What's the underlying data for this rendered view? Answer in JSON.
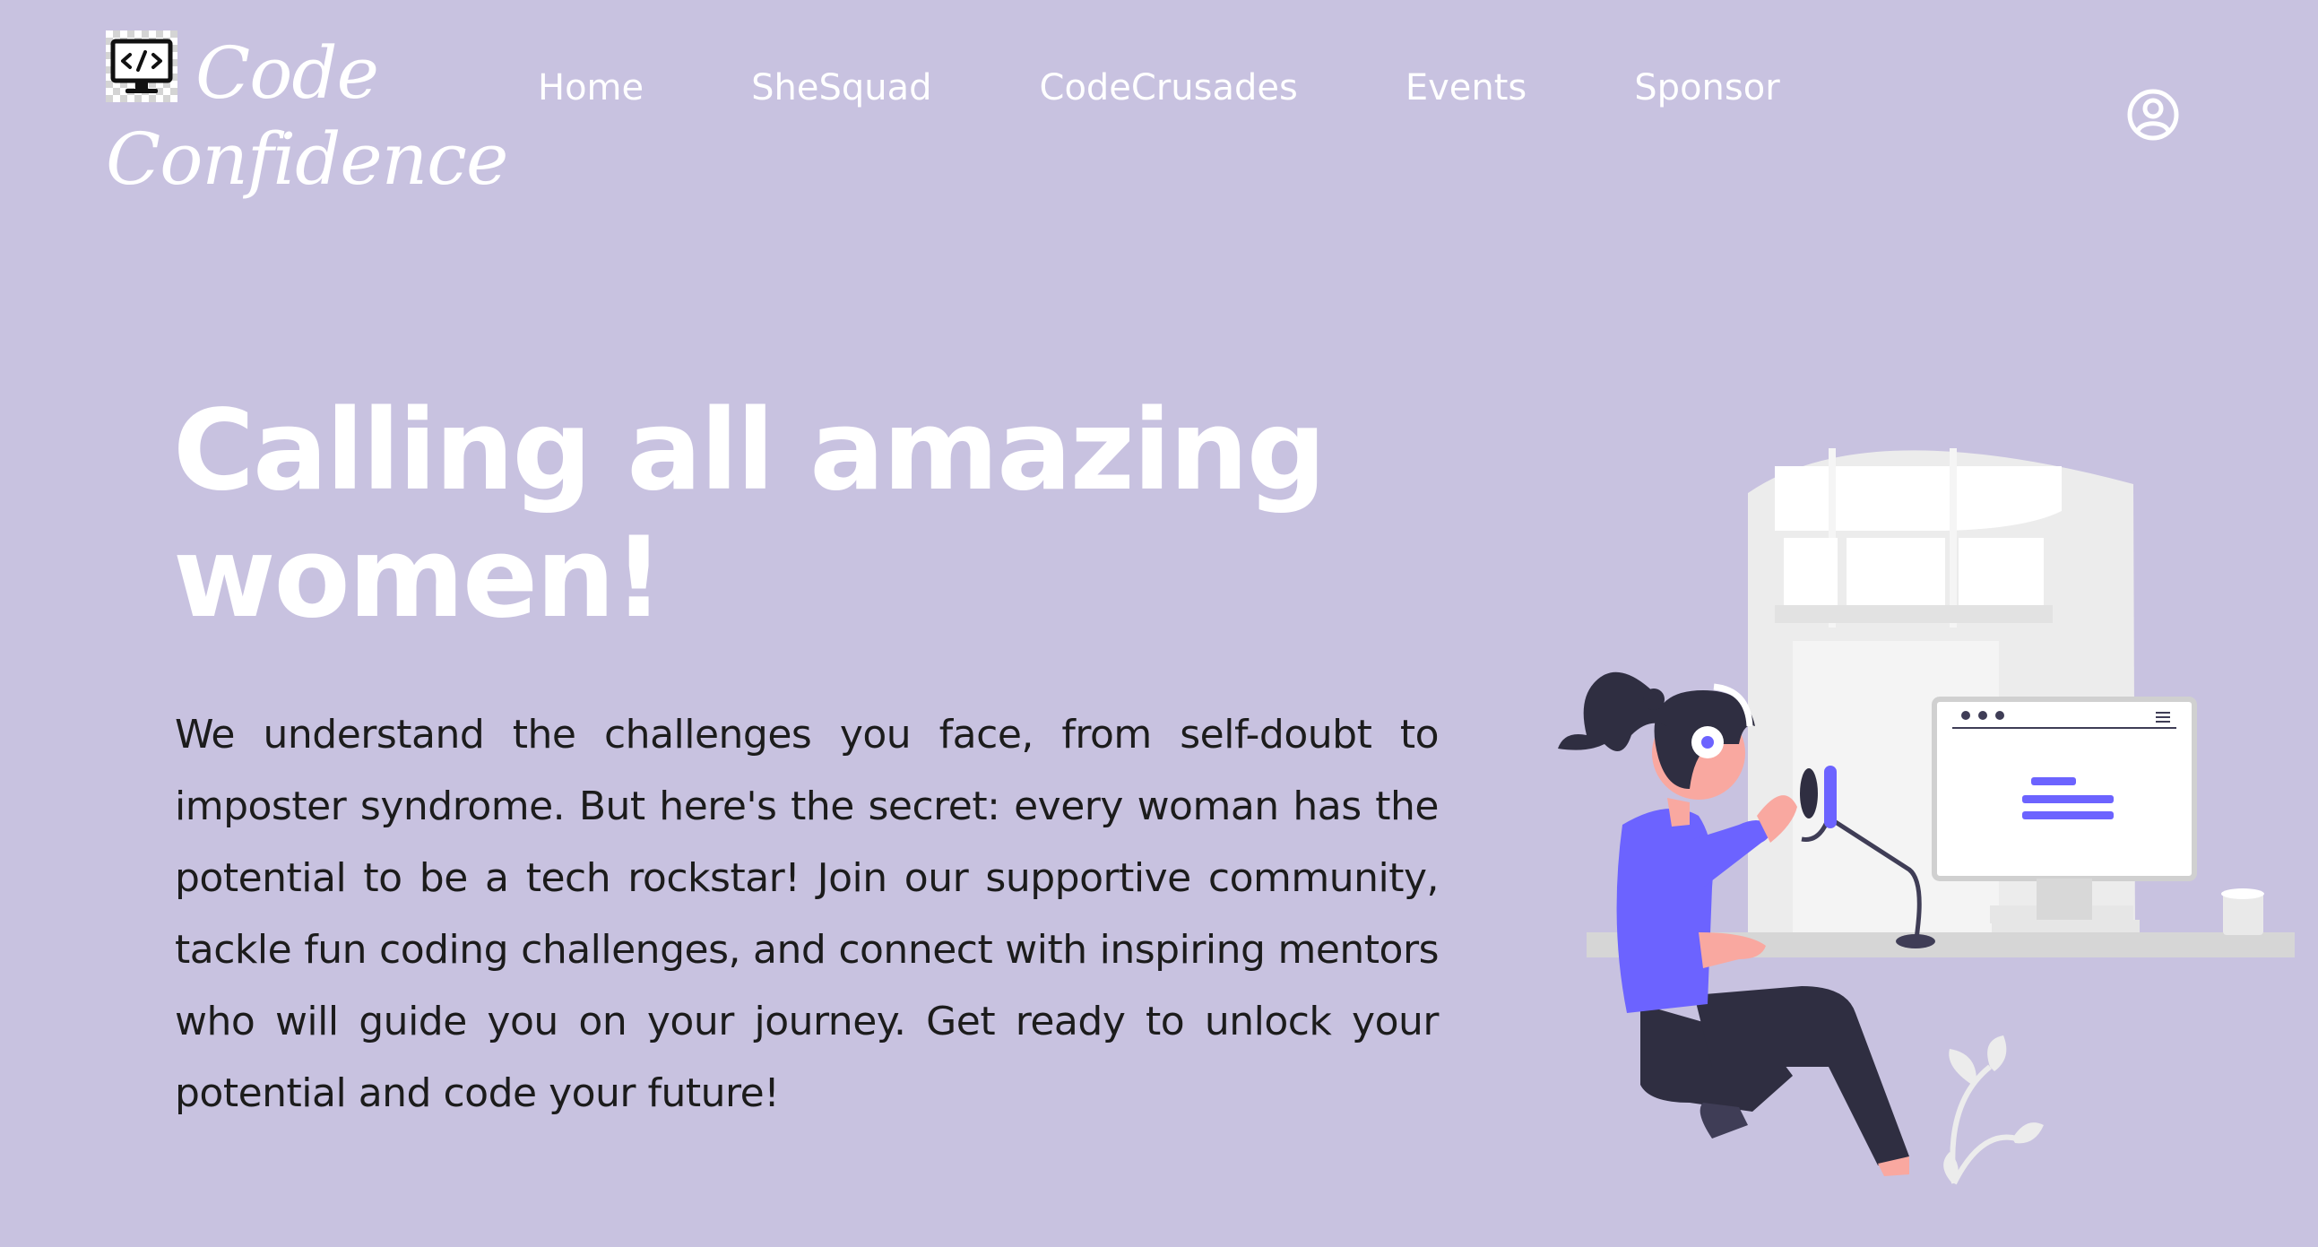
{
  "brand": {
    "line1": "Code",
    "line2": "Confidence",
    "icon": "monitor-code-icon"
  },
  "nav": {
    "items": [
      {
        "label": "Home"
      },
      {
        "label": "SheSquad"
      },
      {
        "label": "CodeCrusades"
      },
      {
        "label": "Events"
      },
      {
        "label": "Sponsor"
      }
    ],
    "account_icon": "user-circle-icon"
  },
  "hero": {
    "title_line1": "Calling all amazing",
    "title_line2": "women!",
    "body": "We understand the challenges you face, from self-doubt to imposter syndrome. But here's the secret: every woman has the potential to be a tech rockstar! Join our supportive community, tackle fun coding challenges, and connect with inspiring mentors who will guide you on your journey. Get ready to unlock your potential and code your future!"
  },
  "illustration": {
    "icon": "woman-coding-with-headset-illustration"
  },
  "colors": {
    "background": "#c8c2e0",
    "text_light": "#ffffff",
    "text_dark": "#1c1c1c",
    "accent": "#6c63ff",
    "dark_figure": "#2f2e41"
  }
}
